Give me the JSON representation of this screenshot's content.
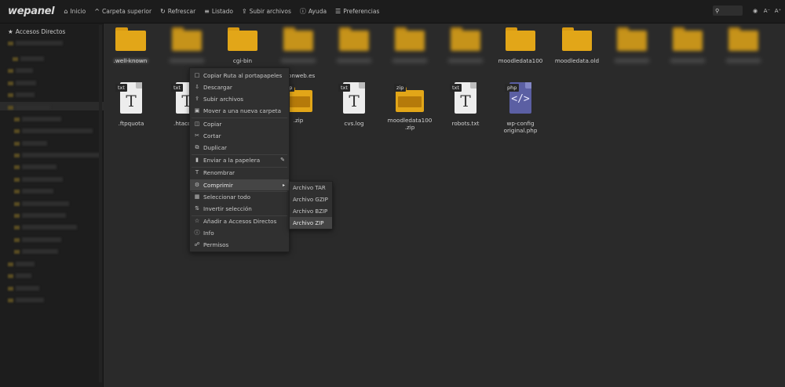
{
  "topbar": {
    "logo": "wepanel",
    "nav": [
      {
        "label": "Inicio",
        "icon": "home-icon"
      },
      {
        "label": "Carpeta superior",
        "icon": "up-arrow-icon"
      },
      {
        "label": "Refrescar",
        "icon": "refresh-icon"
      },
      {
        "label": "Listado",
        "icon": "list-icon"
      },
      {
        "label": "Subir archivos",
        "icon": "upload-icon"
      },
      {
        "label": "Ayuda",
        "icon": "help-icon"
      },
      {
        "label": "Preferencias",
        "icon": "sliders-icon"
      }
    ],
    "search_icon": "search-icon",
    "right_buttons": [
      "view-icon",
      "font-decrease-icon",
      "font-increase-icon"
    ]
  },
  "sidebar": {
    "title": "Accesos Directos",
    "title_icon": "star-icon"
  },
  "files": {
    "row1": [
      {
        "name": "",
        "type": "folder",
        "blurred": true
      },
      {
        "name": "",
        "type": "folder",
        "blurred": true
      },
      {
        "name": ".well-known",
        "type": "folder",
        "blurred": false
      },
      {
        "name": "cgi-bin",
        "type": "folder",
        "blurred": false
      },
      {
        "name": "",
        "type": "folder",
        "blurred": true
      },
      {
        "name": "",
        "type": "folder",
        "blurred": true
      },
      {
        "name": "",
        "type": "folder",
        "blurred": true
      },
      {
        "name": "moodledata100",
        "type": "folder",
        "blurred": false
      },
      {
        "name": "moodledata.old",
        "type": "folder",
        "blurred": false
      },
      {
        "name": "",
        "type": "folder",
        "blurred": true
      },
      {
        "name": "",
        "type": "folder",
        "blurred": true
      },
      {
        "name": "",
        "type": "folder",
        "blurred": true
      }
    ],
    "row1_extra_label": "onweb.es",
    "row2": [
      {
        "name": ".ftpquota",
        "type": "doc",
        "tag": "txt"
      },
      {
        "name": ".htaccess",
        "type": "doc",
        "tag": "txt"
      },
      {
        "name": ".zip",
        "type": "zip",
        "tag": "zip"
      },
      {
        "name": "cvs.log",
        "type": "doc",
        "tag": "txt"
      },
      {
        "name": "moodledata100\n.zip",
        "type": "zip",
        "tag": "zip"
      },
      {
        "name": "robots.txt",
        "type": "doc",
        "tag": "txt"
      },
      {
        "name": "wp-config\noriginal.php",
        "type": "php",
        "tag": "php"
      }
    ]
  },
  "context_menu": {
    "items": [
      {
        "label": "Copiar Ruta al portapapeles",
        "icon": "clipboard-icon"
      },
      {
        "label": "Descargar",
        "icon": "download-icon"
      },
      {
        "label": "Subir archivos",
        "icon": "upload-icon"
      },
      {
        "label": "Mover a una nueva carpeta",
        "icon": "folder-move-icon"
      },
      {
        "label": "Copiar",
        "icon": "copy-icon"
      },
      {
        "label": "Cortar",
        "icon": "scissors-icon"
      },
      {
        "label": "Duplicar",
        "icon": "duplicate-icon"
      },
      {
        "label": "Enviar a la papelera",
        "icon": "trash-icon"
      },
      {
        "label": "Renombrar",
        "icon": "rename-icon"
      },
      {
        "label": "Comprimir",
        "icon": "compress-icon"
      },
      {
        "label": "Seleccionar todo",
        "icon": "select-all-icon"
      },
      {
        "label": "Invertir selección",
        "icon": "invert-selection-icon"
      },
      {
        "label": "Añadir a Accesos Directos",
        "icon": "star-icon"
      },
      {
        "label": "Info",
        "icon": "info-icon"
      },
      {
        "label": "Permisos",
        "icon": "permissions-icon"
      }
    ],
    "active_item": "Comprimir"
  },
  "compress_submenu": {
    "items": [
      "Archivo TAR",
      "Archivo GZIP",
      "Archivo BZIP",
      "Archivo ZIP"
    ],
    "active_item": "Archivo ZIP"
  }
}
